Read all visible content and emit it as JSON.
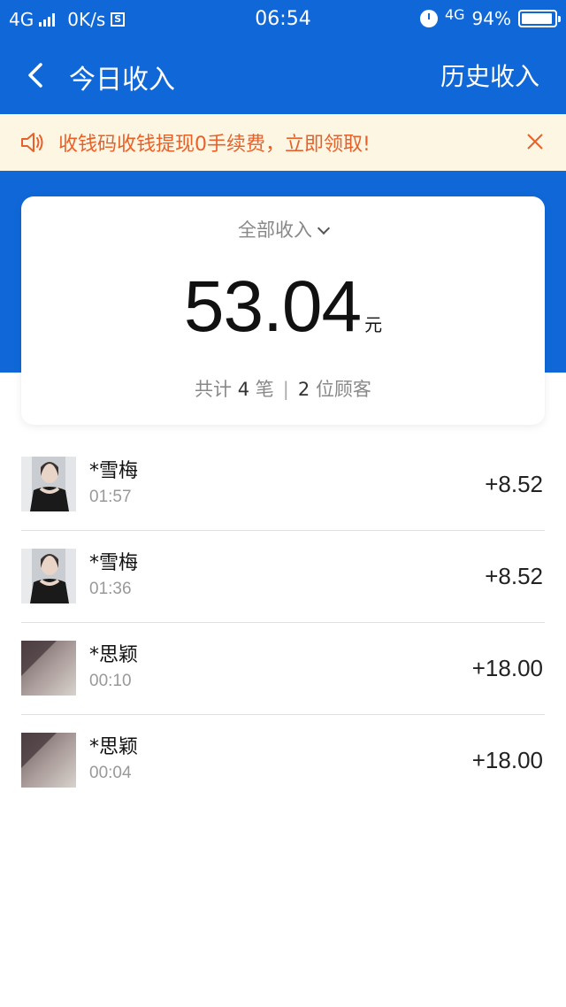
{
  "status_bar": {
    "network": "4G",
    "speed": "0K/s",
    "badge": "S",
    "time": "06:54",
    "network_right": "4G",
    "battery": "94%",
    "battery_level": 0.94
  },
  "nav": {
    "title": "今日收入",
    "history": "历史收入"
  },
  "banner": {
    "text": "收钱码收钱提现0手续费，立即领取!"
  },
  "summary": {
    "filter": "全部收入",
    "amount": "53.04",
    "unit": "元",
    "count_prefix": "共计",
    "count": "4",
    "count_unit": "笔",
    "customers": "2",
    "customers_unit": "位顾客"
  },
  "transactions": [
    {
      "name": "*雪梅",
      "time": "01:57",
      "amount": "+8.52"
    },
    {
      "name": "*雪梅",
      "time": "01:36",
      "amount": "+8.52"
    },
    {
      "name": "*思颖",
      "time": "00:10",
      "amount": "+18.00"
    },
    {
      "name": "*思颖",
      "time": "00:04",
      "amount": "+18.00"
    }
  ],
  "colors": {
    "primary": "#1068d8",
    "banner_bg": "#fdf6e3",
    "banner_text": "#e8612a"
  }
}
